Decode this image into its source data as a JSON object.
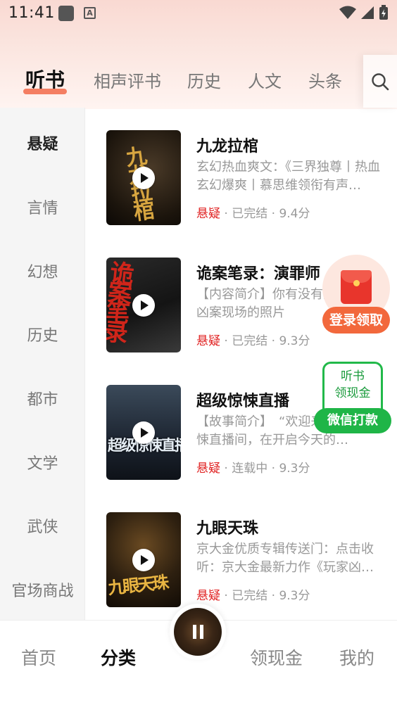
{
  "status_bar": {
    "time": "11:41"
  },
  "tabs": [
    {
      "label": "听书",
      "active": true
    },
    {
      "label": "相声评书",
      "active": false
    },
    {
      "label": "历史",
      "active": false
    },
    {
      "label": "人文",
      "active": false
    },
    {
      "label": "头条",
      "active": false
    }
  ],
  "search": {
    "icon": "search-icon"
  },
  "sidebar": {
    "items": [
      {
        "label": "悬疑",
        "active": true
      },
      {
        "label": "言情"
      },
      {
        "label": "幻想"
      },
      {
        "label": "历史"
      },
      {
        "label": "都市"
      },
      {
        "label": "文学"
      },
      {
        "label": "武侠"
      },
      {
        "label": "官场商战"
      }
    ]
  },
  "books": [
    {
      "title": "九龙拉棺",
      "desc": "玄幻热血爽文：《三界独尊丨热血玄幻爆爽丨慕思维领衔有声…",
      "genre": "悬疑",
      "status": "已完结",
      "score": "9.4分",
      "cover_text": "九龙拉棺"
    },
    {
      "title": "诡案笔录：演罪师",
      "desc": "【内容简介】你有没有见某一张凶案现场的照片",
      "genre": "悬疑",
      "status": "已完结",
      "score": "9.3分",
      "cover_text": "诡案笔录"
    },
    {
      "title": "超级惊悚直播",
      "desc": "【故事简介】　“欢迎来到超级惊悚直播间，在开启今天的…",
      "genre": "悬疑",
      "status": "连载中",
      "score": "9.3分",
      "cover_text": "超级惊悚直播"
    },
    {
      "title": "九眼天珠",
      "desc": "京大金优质专辑传送门：点击收听：京大金最新力作《玩家凶…",
      "genre": "悬疑",
      "status": "已完结",
      "score": "9.3分",
      "cover_text": "九眼天珠"
    }
  ],
  "meta_separator": "·",
  "floating": {
    "login_reward": "登录领取",
    "wechat_top": [
      "听书",
      "领现金"
    ],
    "wechat_button": "微信打款"
  },
  "bottom_nav": [
    {
      "label": "首页",
      "active": false
    },
    {
      "label": "分类",
      "active": true
    },
    {
      "label": "领现金",
      "active": false
    },
    {
      "label": "我的",
      "active": false
    }
  ],
  "colors": {
    "accent": "#f26a4a",
    "genre_red": "#e02020",
    "wechat_green": "#1fb547"
  }
}
